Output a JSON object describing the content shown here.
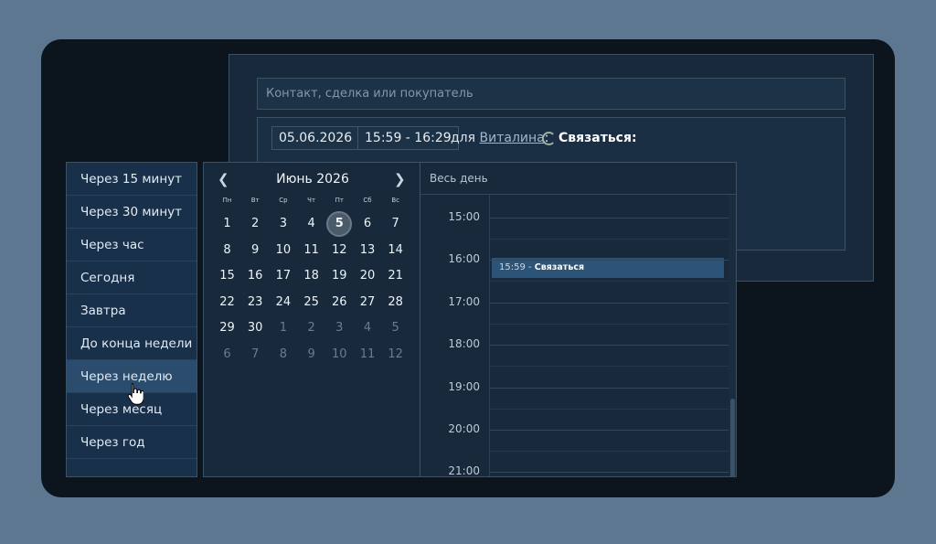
{
  "task": {
    "search_placeholder": "Контакт, сделка или покупатель",
    "date": "05.06.2026",
    "time_range": "15:59 - 16:29",
    "for_label": "для",
    "user": "Виталина",
    "colon": ":",
    "action": "Связаться:"
  },
  "quick_options": [
    "Через 15 минут",
    "Через 30 минут",
    "Через час",
    "Сегодня",
    "Завтра",
    "До конца недели",
    "Через неделю",
    "Через месяц",
    "Через год"
  ],
  "calendar": {
    "month_label": "Июнь 2026",
    "prev_icon": "chevron-left-icon",
    "next_icon": "chevron-right-icon",
    "weekdays": [
      "Пн",
      "Вт",
      "Ср",
      "Чт",
      "Пт",
      "Сб",
      "Вс"
    ],
    "days": [
      [
        "1",
        "2",
        "3",
        "4",
        "5",
        "6",
        "7"
      ],
      [
        "8",
        "9",
        "10",
        "11",
        "12",
        "13",
        "14"
      ],
      [
        "15",
        "16",
        "17",
        "18",
        "19",
        "20",
        "21"
      ],
      [
        "22",
        "23",
        "24",
        "25",
        "26",
        "27",
        "28"
      ],
      [
        "29",
        "30",
        "1",
        "2",
        "3",
        "4",
        "5"
      ],
      [
        "6",
        "7",
        "8",
        "9",
        "10",
        "11",
        "12"
      ]
    ],
    "selected_day": "5"
  },
  "schedule": {
    "all_day_label": "Весь день",
    "hours": [
      "15:00",
      "16:00",
      "17:00",
      "18:00",
      "19:00",
      "20:00",
      "21:00"
    ],
    "event_time": "15:59",
    "event_sep": " - ",
    "event_title": "Связаться"
  },
  "colors": {
    "background": "#5d7791",
    "window": "#0c151d",
    "panel": "#17293a",
    "accent": "#2c5378"
  }
}
